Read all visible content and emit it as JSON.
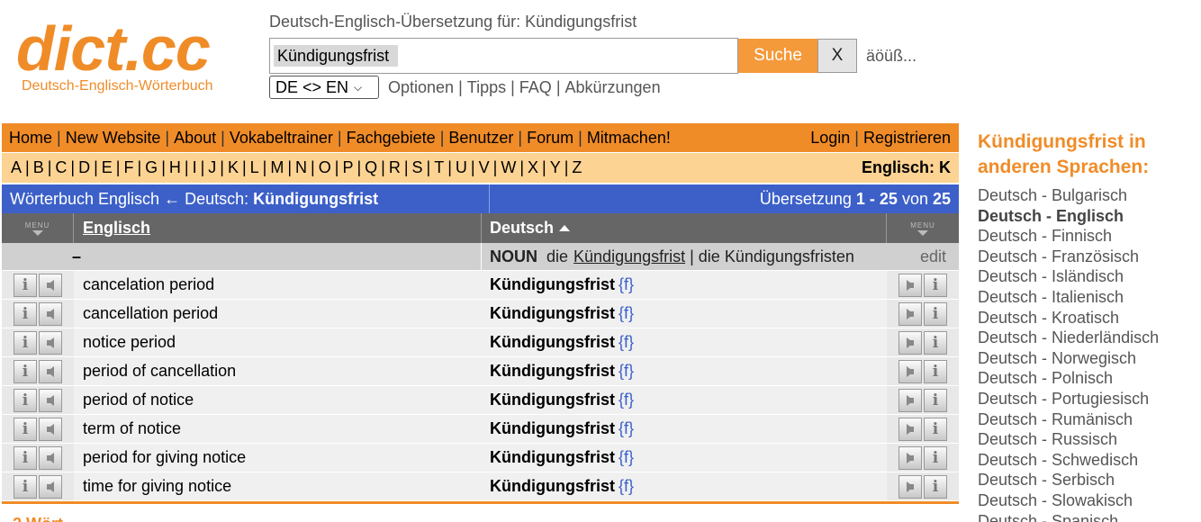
{
  "logo": {
    "text": "dict.cc",
    "subtitle": "Deutsch-Englisch-Wörterbuch"
  },
  "search": {
    "heading": "Deutsch-Englisch-Übersetzung für: Kündigungsfrist",
    "value": "Kündigungsfrist",
    "search_label": "Suche",
    "clear_label": "X",
    "special_chars": "äöüß..."
  },
  "options": {
    "lang_select": "DE <> EN",
    "links": [
      "Optionen",
      "Tipps",
      "FAQ",
      "Abkürzungen"
    ]
  },
  "nav": {
    "left": [
      "Home",
      "New Website",
      "About",
      "Vokabeltrainer",
      "Fachgebiete",
      "Benutzer",
      "Forum",
      "Mitmachen!"
    ],
    "right": [
      "Login",
      "Registrieren"
    ]
  },
  "alphabet": {
    "letters": [
      "A",
      "B",
      "C",
      "D",
      "E",
      "F",
      "G",
      "H",
      "I",
      "J",
      "K",
      "L",
      "M",
      "N",
      "O",
      "P",
      "Q",
      "R",
      "S",
      "T",
      "U",
      "V",
      "W",
      "X",
      "Y",
      "Z"
    ],
    "current": "Englisch: K"
  },
  "title_bar": {
    "left_prefix": "Wörterbuch Englisch ← Deutsch: ",
    "left_term": "Kündigungsfrist",
    "right_prefix": "Übersetzung ",
    "right_range": "1 - 25",
    "right_mid": " von ",
    "right_total": "25"
  },
  "table": {
    "menu_label": "MENU",
    "col_en": "Englisch",
    "col_de": "Deutsch",
    "group": {
      "dash": "–",
      "pos": "NOUN",
      "art1": "die",
      "word": "Kündigungsfrist",
      "sep": "|",
      "plural": "die Kündigungsfristen",
      "edit": "edit"
    },
    "rows": [
      {
        "en": "cancelation period",
        "de": "Kündigungsfrist",
        "gender": "{f}"
      },
      {
        "en": "cancellation period",
        "de": "Kündigungsfrist",
        "gender": "{f}"
      },
      {
        "en": "notice period",
        "de": "Kündigungsfrist",
        "gender": "{f}"
      },
      {
        "en": "period of cancellation",
        "de": "Kündigungsfrist",
        "gender": "{f}"
      },
      {
        "en": "period of notice",
        "de": "Kündigungsfrist",
        "gender": "{f}"
      },
      {
        "en": "term of notice",
        "de": "Kündigungsfrist",
        "gender": "{f}"
      },
      {
        "en": "period for giving notice",
        "de": "Kündigungsfrist",
        "gender": "{f}"
      },
      {
        "en": "time for giving notice",
        "de": "Kündigungsfrist",
        "gender": "{f}"
      }
    ]
  },
  "bottom_cut": "2 Wört",
  "sidebar": {
    "title": "Kündigungsfrist in anderen Sprachen:",
    "languages": [
      "Deutsch - Bulgarisch",
      "Deutsch - Englisch",
      "Deutsch - Finnisch",
      "Deutsch - Französisch",
      "Deutsch - Isländisch",
      "Deutsch - Italienisch",
      "Deutsch - Kroatisch",
      "Deutsch - Niederländisch",
      "Deutsch - Norwegisch",
      "Deutsch - Polnisch",
      "Deutsch - Portugiesisch",
      "Deutsch - Rumänisch",
      "Deutsch - Russisch",
      "Deutsch - Schwedisch",
      "Deutsch - Serbisch",
      "Deutsch - Slowakisch",
      "Deutsch - Spanisch"
    ],
    "active": "Deutsch - Englisch"
  },
  "colors": {
    "brand_orange": "#f08c28",
    "nav_light": "#fcd393",
    "title_blue": "#3c60c8",
    "gender_blue": "#3a5fcc"
  },
  "icons": [
    "info-icon",
    "speaker-icon",
    "menu-arrow-icon",
    "sort-up-icon",
    "chevron-down-icon"
  ]
}
